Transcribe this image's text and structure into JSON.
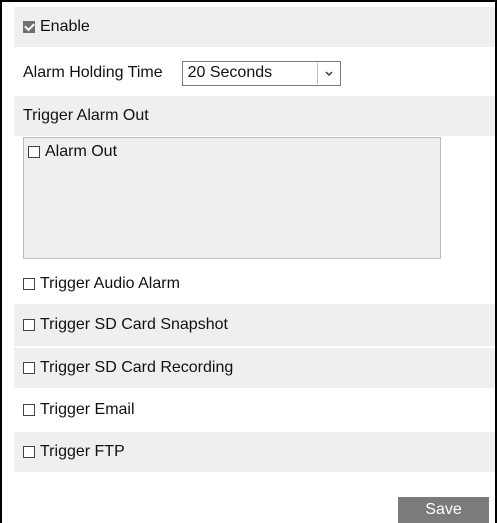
{
  "enable": {
    "label": "Enable",
    "checked": true
  },
  "alarm_holding_time": {
    "label": "Alarm Holding Time",
    "value": "20 Seconds"
  },
  "trigger_alarm_out": {
    "heading": "Trigger Alarm Out",
    "items": [
      {
        "label": "Alarm Out",
        "checked": false
      }
    ]
  },
  "triggers": [
    {
      "label": "Trigger Audio Alarm",
      "checked": false
    },
    {
      "label": "Trigger SD Card Snapshot",
      "checked": false
    },
    {
      "label": "Trigger SD Card Recording",
      "checked": false
    },
    {
      "label": "Trigger Email",
      "checked": false
    },
    {
      "label": "Trigger FTP",
      "checked": false
    }
  ],
  "save_label": "Save",
  "colors": {
    "shade": "#efefef",
    "button": "#7b7b7b",
    "checkbox_checked": "#6f6f6f"
  }
}
